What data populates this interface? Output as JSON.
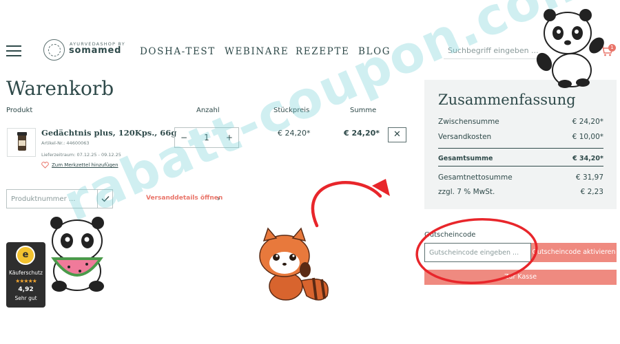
{
  "header": {
    "logo_small": "AYURVEDASHOP BY",
    "logo_name": "somamed",
    "nav": [
      "DOSHA-TEST",
      "WEBINARE",
      "REZEPTE",
      "BLOG"
    ],
    "search_placeholder": "Suchbegriff eingeben ...",
    "cart_count": "1"
  },
  "cart": {
    "title": "Warenkorb",
    "columns": {
      "product": "Produkt",
      "qty": "Anzahl",
      "unit_price": "Stückpreis",
      "sum": "Summe"
    },
    "item": {
      "name": "Gedächtnis plus, 120Kps., 66g",
      "article": "Artikel-Nr.: 44600063",
      "delivery": "Lieferzeitraum: 07.12.25 - 09.12.25",
      "wishlist": "Zum Merkzettel hinzufügen",
      "qty": "1",
      "unit_price": "€ 24,20*",
      "sum": "€ 24,20*"
    },
    "product_number_placeholder": "Produktnummer ...",
    "shipping_link": "Versanddetails öffnen"
  },
  "summary": {
    "title": "Zusammenfassung",
    "rows": [
      {
        "label": "Zwischensumme",
        "value": "€ 24,20*"
      },
      {
        "label": "Versandkosten",
        "value": "€ 10,00*"
      }
    ],
    "total": {
      "label": "Gesamtsumme",
      "value": "€ 34,20*"
    },
    "rows2": [
      {
        "label": "Gesamtnettosumme",
        "value": "€ 31,97"
      },
      {
        "label": "zzgl. 7 % MwSt.",
        "value": "€ 2,23"
      }
    ],
    "coupon_label": "Gutscheincode",
    "coupon_placeholder": "Gutscheincode eingeben ...",
    "coupon_button": "Gutscheincode aktivieren",
    "checkout_button": "Zur Kasse"
  },
  "trust_badge": {
    "label": "Käuferschutz",
    "stars": "★★★★★",
    "score": "4,92",
    "grade": "Sehr gut"
  },
  "watermark": "rabatt-coupon.com",
  "colors": {
    "primary": "#2f4a4a",
    "accent": "#ef8a80",
    "summary_bg": "#f1f3f3",
    "annotation": "#e8262b"
  }
}
